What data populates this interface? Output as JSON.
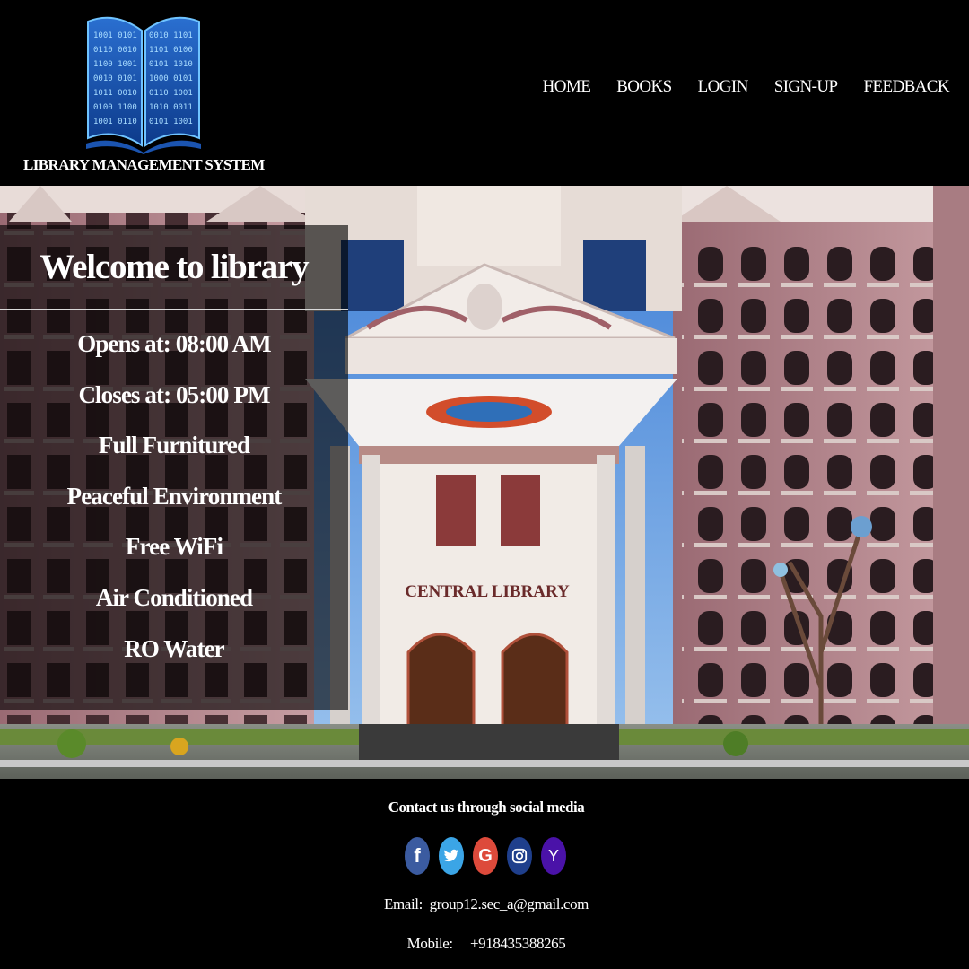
{
  "header": {
    "logo_text": "LIBRARY MANAGEMENT SYSTEM",
    "logo_icon": "binary-book-icon",
    "nav": [
      {
        "label": "HOME"
      },
      {
        "label": "BOOKS"
      },
      {
        "label": "LOGIN"
      },
      {
        "label": "SIGN-UP"
      },
      {
        "label": "FEEDBACK"
      }
    ]
  },
  "hero": {
    "building_sign": "CENTRAL LIBRARY",
    "welcome": {
      "title": "Welcome to library",
      "features": [
        "Opens at: 08:00 AM",
        "Closes at: 05:00 PM",
        "Full Furnitured",
        "Peaceful Environment",
        "Free WiFi",
        "Air Conditioned",
        "RO Water"
      ]
    }
  },
  "footer": {
    "heading": "Contact us through social media",
    "socials": [
      {
        "name": "facebook-icon",
        "glyph": "f",
        "color": "#3b5ba0"
      },
      {
        "name": "twitter-icon",
        "glyph": "🐦",
        "color": "#3ba5e6"
      },
      {
        "name": "google-icon",
        "glyph": "G",
        "color": "#dd4a3b"
      },
      {
        "name": "instagram-icon",
        "glyph": "◎",
        "color": "#1f3f8c"
      },
      {
        "name": "yahoo-icon",
        "glyph": "Y",
        "color": "#4a12a8"
      }
    ],
    "email_label": "Email:",
    "email": "group12.sec_a@gmail.com",
    "mobile_label": "Mobile:",
    "mobile": "+918435388265"
  }
}
